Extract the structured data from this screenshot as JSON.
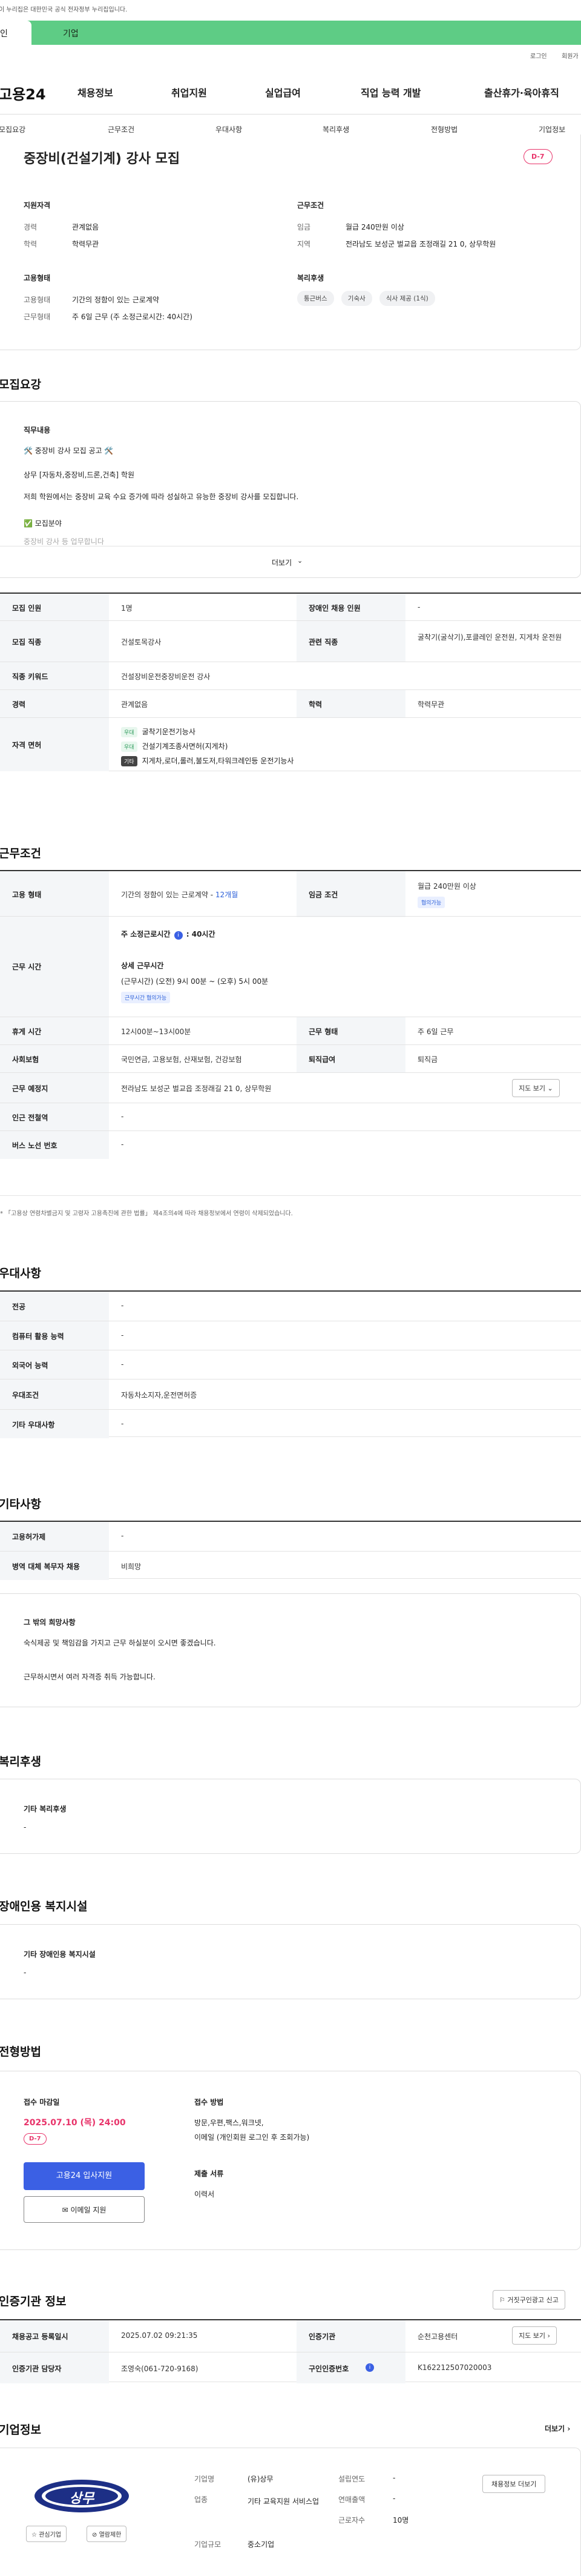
{
  "gov_banner": "이 누리집은 대한민국 공식 전자정부 누리집입니다.",
  "top_tabs": [
    "인",
    "기업"
  ],
  "util": {
    "login": "로그인",
    "join": "회원가"
  },
  "logo": "고용24",
  "gnb": [
    "채용정보",
    "취업지원",
    "실업급여",
    "직업 능력 개발",
    "출산휴가·육아휴직"
  ],
  "subnav": [
    "모집요강",
    "근무조건",
    "우대사항",
    "복리후생",
    "전형방법",
    "기업정보"
  ],
  "job": {
    "title": "중장비(건설기계) 강사 모집",
    "dday": "D-7"
  },
  "summary": {
    "req_title": "지원자격",
    "career_k": "경력",
    "career_v": "관계없음",
    "edu_k": "학력",
    "edu_v": "학력무관",
    "cond_title": "근무조건",
    "wage_k": "임금",
    "wage_v": "월급 240만원 이상",
    "loc_k": "지역",
    "loc_v": "전라남도 보성군 벌교읍 조정래길 21 0, 상무학원",
    "emp_title": "고용형태",
    "emp_k": "고용형태",
    "emp_v": "기간의 정함이 있는 근로계약",
    "work_k": "근무형태",
    "work_v": "주 6일 근무 (주 소정근로시간: 40시간)",
    "welfare_title": "복리후생",
    "welfare": [
      "통근버스",
      "기숙사",
      "식사 제공 (1식)"
    ]
  },
  "recruit": {
    "title": "모집요강",
    "duty_title": "직무내용",
    "line1": "🛠️ 중장비 강사 모집 공고 🛠️",
    "line2": "상무 [자동차,중장비,드론,건축] 학원",
    "line3": "저희 학원에서는 중장비 교육 수요 증가에 따라 성실하고 유능한 중장비 강사를 모집합니다.",
    "line4": "✅ 모집분야",
    "line5": "중장비 강사 등 업무합니다",
    "more": "더보기"
  },
  "recruit_table": {
    "num_k": "모집 인원",
    "num_v": "1명",
    "dis_k": "장애인 채용 인원",
    "dis_v": "-",
    "job_k": "모집 직종",
    "job_v": "건설토목강사",
    "rel_k": "관련 직종",
    "rel_v": "굴착기(굴삭기),포클레인 운전원, 지게차 운전원",
    "kw_k": "직종 키워드",
    "kw_v": "건설장비운전중장비운전 강사",
    "career_k": "경력",
    "career_v": "관계없음",
    "edu_k": "학력",
    "edu_v": "학력무관",
    "lic_k": "자격 면허",
    "lic": [
      {
        "badge": "우대",
        "name": "굴착기운전기능사"
      },
      {
        "badge": "우대",
        "name": "건설기계조종사면허(지게차)"
      },
      {
        "badge": "기타",
        "name": "지게차,로더,롤러,불도저,타워크레인등 운전기능사"
      }
    ]
  },
  "cond": {
    "title": "근무조건",
    "type_k": "고용 형태",
    "type_v": "기간의 정함이 있는 근로계약 - ",
    "type_link": "12개월",
    "wage_k": "임금 조건",
    "wage_v": "월급 240만원 이상",
    "wage_badge": "협의가능",
    "hours_k": "근무 시간",
    "hours_title": "주 소정근로시간",
    "hours_val": ": 40시간",
    "detail_title": "상세 근무시간",
    "detail_v": "(근무시간) (오전) 9시 00분 ~ (오후) 5시 00분",
    "detail_badge": "근무시간 협의가능",
    "break_k": "휴게 시간",
    "break_v": "12시00분~13시00분",
    "form_k": "근무 형태",
    "form_v": "주 6일 근무",
    "ins_k": "사회보험",
    "ins_v": "국민연금, 고용보험, 산재보험, 건강보험",
    "ret_k": "퇴직급여",
    "ret_v": "퇴직금",
    "place_k": "근무 예정지",
    "place_v": "전라남도 보성군 벌교읍 조정래길 21 0, 상무학원",
    "map": "지도 보기",
    "sub_k": "인근 전철역",
    "sub_v": "-",
    "bus_k": "버스 노선 번호",
    "bus_v": "-",
    "note": "* 「고용상 연령차별금지 및 고령자 고용촉진에 관한 법률」 제4조의4에 따라 채용정보에서 연령이 삭제되었습니다."
  },
  "pref": {
    "title": "우대사항",
    "major_k": "전공",
    "major_v": "-",
    "pc_k": "컴퓨터 활용 능력",
    "pc_v": "-",
    "lang_k": "외국어 능력",
    "lang_v": "-",
    "cond_k": "우대조건",
    "cond_v": "자동차소지자,운전면허증",
    "etc_k": "기타 우대사항",
    "etc_v": "-"
  },
  "other": {
    "title": "기타사항",
    "emp_k": "고용허가제",
    "emp_v": "-",
    "mil_k": "병역 대체 복무자 채용",
    "mil_v": "비희망",
    "wish_title": "그 밖의 희망사항",
    "wish1": "숙식제공 및 책임감을 가지고 근무 하실분이 오시면 좋겠습니다.",
    "wish2": "근무하시면서 여러 자격증 취득 가능합니다."
  },
  "welfare": {
    "title": "복리후생",
    "sub": "기타 복리후생",
    "v": "-"
  },
  "disab": {
    "title": "장애인용 복지시설",
    "sub": "기타 장애인용 복지시설",
    "v": "-"
  },
  "process": {
    "title": "전형방법",
    "deadline_title": "접수 마감일",
    "deadline": "2025.07.10 (목) 24:00",
    "dday": "D-7",
    "apply": "고용24 입사지원",
    "email": "이메일 지원",
    "method_title": "접수 방법",
    "method": "방문,우편,팩스,워크넷,",
    "method2": "이메일 (개인회원 로그인 후 조회가능)",
    "doc_title": "제출 서류",
    "doc": "이력서"
  },
  "cert": {
    "title": "인증기관 정보",
    "report": "거짓구인광고 신고",
    "reg_k": "채용공고 등록일시",
    "reg_v": "2025.07.02 09:21:35",
    "org_k": "인증기관",
    "org_v": "순천고용센터",
    "map": "지도 보기",
    "mgr_k": "인증기관 담당자",
    "mgr_v": "조영숙(061-720-9168)",
    "id_k": "구인인증번호",
    "id_v": "K162212507020003"
  },
  "company": {
    "title": "기업정보",
    "more": "더보기",
    "logo_text": "상무",
    "fav": "관심기업",
    "block": "열람제한",
    "name_k": "기업명",
    "name_v": "(유)상무",
    "biz_k": "업종",
    "biz_v": "기타 교육지원 서비스업",
    "size_k": "기업규모",
    "size_v": "중소기업",
    "year_k": "설립연도",
    "year_v": "-",
    "rev_k": "연매출액",
    "rev_v": "-",
    "emp_k": "근로자수",
    "emp_v": "10명",
    "intro": "채용정보 더보기"
  }
}
